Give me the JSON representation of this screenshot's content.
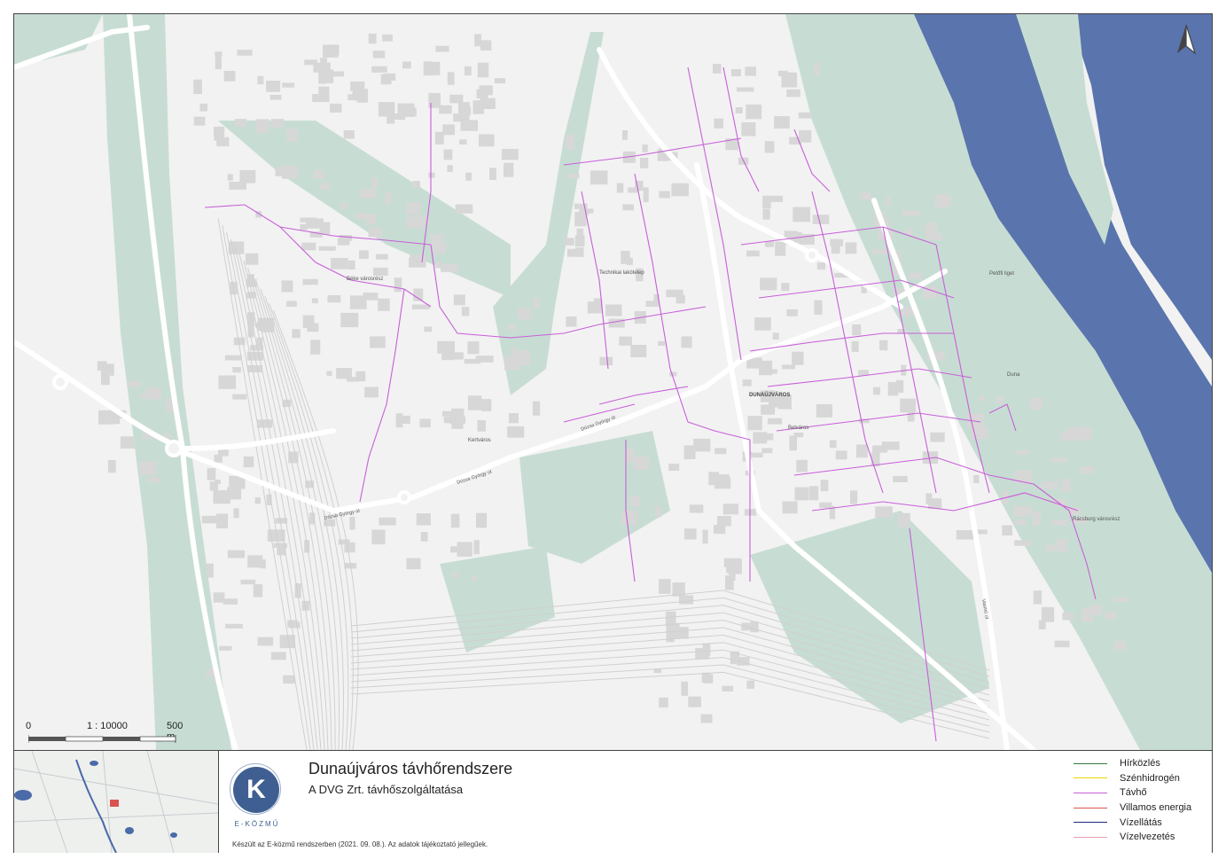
{
  "map": {
    "place_labels": [
      {
        "id": "dunaujvaros",
        "text": "DUNAÚJVÁROS"
      },
      {
        "id": "technikai",
        "text": "Technikai lakótelep"
      },
      {
        "id": "belvaros",
        "text": "Belváros"
      },
      {
        "id": "beke",
        "text": "Béke városrész"
      },
      {
        "id": "kertvaros",
        "text": "Kertváros"
      },
      {
        "id": "radar",
        "text": "Rácsburg városrész"
      },
      {
        "id": "duna",
        "text": "Duna"
      },
      {
        "id": "petofi",
        "text": "Petőfi liget"
      },
      {
        "id": "dozsa1",
        "text": "Dózsa György út"
      },
      {
        "id": "dozsa2",
        "text": "Dózsa György út"
      },
      {
        "id": "dozsa3",
        "text": "Dózsa György út"
      },
      {
        "id": "vasmu",
        "text": "Vasmű út"
      }
    ],
    "colors": {
      "background": "#f2f2f2",
      "green": "#c7ddd3",
      "water": "#5a74ad",
      "building": "#d7d7d7",
      "road": "#ffffff",
      "district_heating": "#c85fd9"
    }
  },
  "scale": {
    "left": "0",
    "ratio": "1 : 10000",
    "right": "500 m"
  },
  "north_arrow": "north-arrow-icon",
  "footer": {
    "title": "Dunaújváros távhőrendszere",
    "subtitle": "A DVG Zrt. távhőszolgáltatása",
    "credit": "Készült az E-közmű rendszerben (2021. 09. 08.). Az adatok tájékoztató jellegűek.",
    "logo_letter": "K",
    "logo_text": "E-KÖZMŰ"
  },
  "legend": [
    {
      "label": "Hírközlés",
      "color": "#3a7a3a"
    },
    {
      "label": "Szénhidrogén",
      "color": "#e8d800"
    },
    {
      "label": "Távhő",
      "color": "#c85fd9"
    },
    {
      "label": "Villamos energia",
      "color": "#d9534f"
    },
    {
      "label": "Vízellátás",
      "color": "#1b2a7a"
    },
    {
      "label": "Vízelvezetés",
      "color": "#e8a0b0"
    }
  ]
}
